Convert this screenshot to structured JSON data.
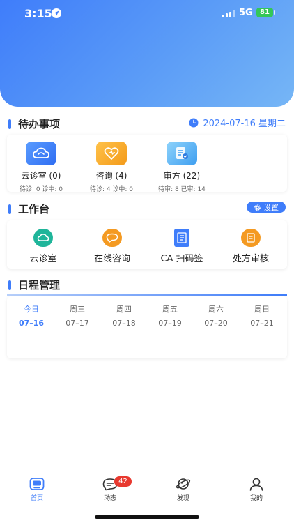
{
  "status_bar": {
    "time": "3:15",
    "network": "5G",
    "battery": "81"
  },
  "todo": {
    "title": "待办事项",
    "date": "2024-07-16 星期二",
    "items": [
      {
        "label": "云诊室 (0)",
        "sub": "待诊: 0  诊中: 0",
        "icon": "cloud-clinic-icon",
        "color": "#3f7dfa"
      },
      {
        "label": "咨询 (4)",
        "sub": "待诊: 4  诊中: 0",
        "icon": "consult-heart-icon",
        "color": "#f6a623"
      },
      {
        "label": "审方 (22)",
        "sub": "待审: 8  已审: 14",
        "icon": "prescription-review-icon",
        "color": "#4aaef2"
      }
    ]
  },
  "workbench": {
    "title": "工作台",
    "settings_label": "设置",
    "items": [
      {
        "label": "云诊室",
        "icon": "cloud-clinic-icon",
        "color": "#1fb59a"
      },
      {
        "label": "在线咨询",
        "icon": "consult-chat-icon",
        "color": "#f49a22"
      },
      {
        "label": "CA 扫码签",
        "icon": "ca-scan-icon",
        "color": "#3f7dfa"
      },
      {
        "label": "处方审核",
        "icon": "prescription-audit-icon",
        "color": "#f49a22"
      }
    ]
  },
  "schedule": {
    "title": "日程管理",
    "days": [
      {
        "week": "今日",
        "date": "07–16"
      },
      {
        "week": "周三",
        "date": "07–17"
      },
      {
        "week": "周四",
        "date": "07–18"
      },
      {
        "week": "周五",
        "date": "07–19"
      },
      {
        "week": "周六",
        "date": "07–20"
      },
      {
        "week": "周日",
        "date": "07–21"
      }
    ]
  },
  "tabbar": {
    "items": [
      {
        "label": "首页",
        "icon": "home-icon"
      },
      {
        "label": "动态",
        "icon": "message-icon",
        "badge": "42"
      },
      {
        "label": "发现",
        "icon": "planet-icon"
      },
      {
        "label": "我的",
        "icon": "user-icon"
      }
    ]
  },
  "colors": {
    "accent": "#3f7dfa",
    "badge": "#e8392f"
  }
}
